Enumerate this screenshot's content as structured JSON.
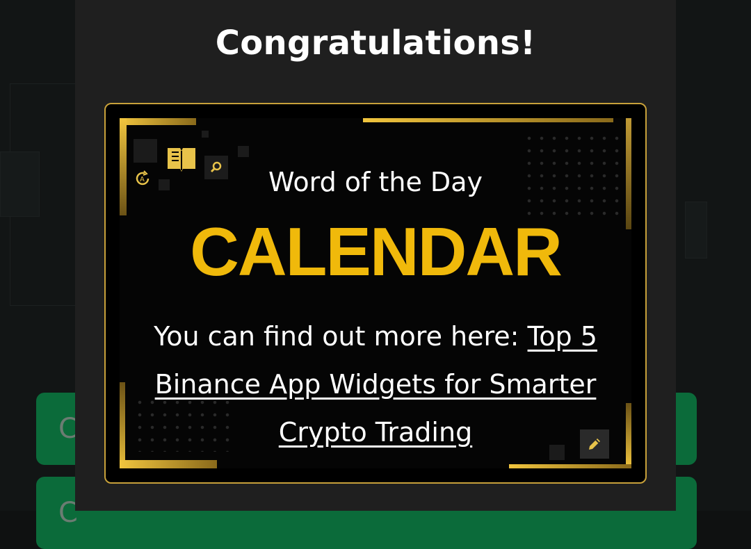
{
  "modal": {
    "title": "Congratulations!"
  },
  "card": {
    "heading": "Word of the Day",
    "word": "CALENDAR",
    "description_prefix": "You can find out more here: ",
    "link_text": "Top 5 Binance App Widgets for Smarter Crypto Trading"
  },
  "colors": {
    "accent": "#f0b90b",
    "card_border": "#c8a13a",
    "modal_bg": "#1f1f1f",
    "button_green": "#0b6b3a"
  },
  "icons": [
    "book-icon",
    "search-icon",
    "refresh-icon",
    "edit-icon"
  ]
}
